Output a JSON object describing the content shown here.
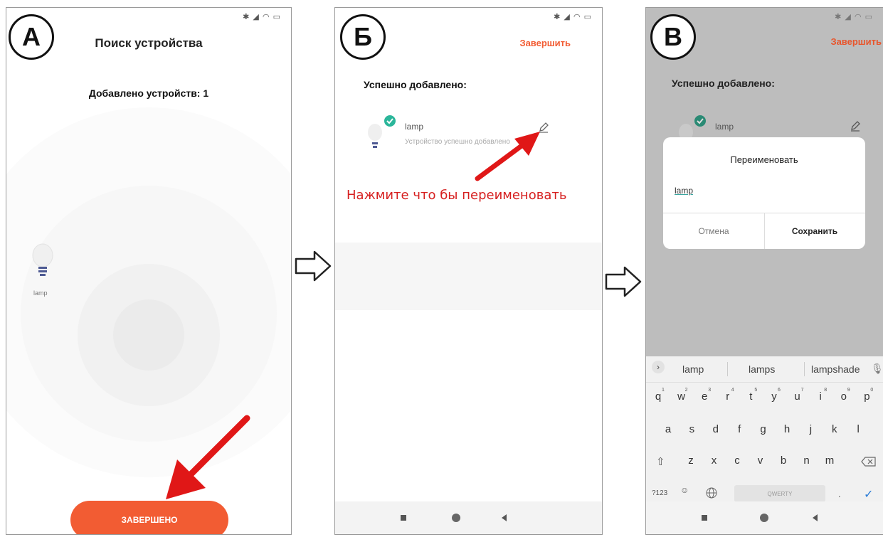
{
  "step_labels": [
    "А",
    "Б",
    "В"
  ],
  "panel_a": {
    "title": "Поиск устройства",
    "added_count": "Добавлено устройств: 1",
    "device_label": "lamp",
    "done_button": "ЗАВЕРШЕНО"
  },
  "panel_b": {
    "finish_link": "Завершить",
    "success_heading": "Успешно добавлено:",
    "device_name": "lamp",
    "device_status": "Устройство успешно добавлено",
    "hint": "Нажмите что бы переименовать"
  },
  "panel_c": {
    "finish_link": "Завершить",
    "success_heading": "Успешно добавлено:",
    "device_name": "lamp",
    "dialog": {
      "title": "Переименовать",
      "input_value": "lamp",
      "cancel": "Отмена",
      "save": "Сохранить"
    },
    "keyboard": {
      "suggestions": [
        "lamp",
        "lamps",
        "lampshade"
      ],
      "row1": [
        "q",
        "w",
        "e",
        "r",
        "t",
        "y",
        "u",
        "i",
        "o",
        "p"
      ],
      "row1_digits": [
        "1",
        "2",
        "3",
        "4",
        "5",
        "6",
        "7",
        "8",
        "9",
        "0"
      ],
      "row2": [
        "a",
        "s",
        "d",
        "f",
        "g",
        "h",
        "j",
        "k",
        "l"
      ],
      "row3": [
        "z",
        "x",
        "c",
        "v",
        "b",
        "n",
        "m"
      ],
      "symbols_key": "?123",
      "space_label": "QWERTY",
      "period": "."
    }
  },
  "colors": {
    "accent": "#f25c33",
    "hint_red": "#d61f1f",
    "check_green": "#2bb69a"
  },
  "icons": [
    "bulb-icon",
    "check-badge-icon",
    "pencil-icon",
    "red-arrow-icon",
    "right-arrow-icon",
    "mic-icon",
    "globe-icon",
    "backspace-icon",
    "enter-check-icon"
  ]
}
